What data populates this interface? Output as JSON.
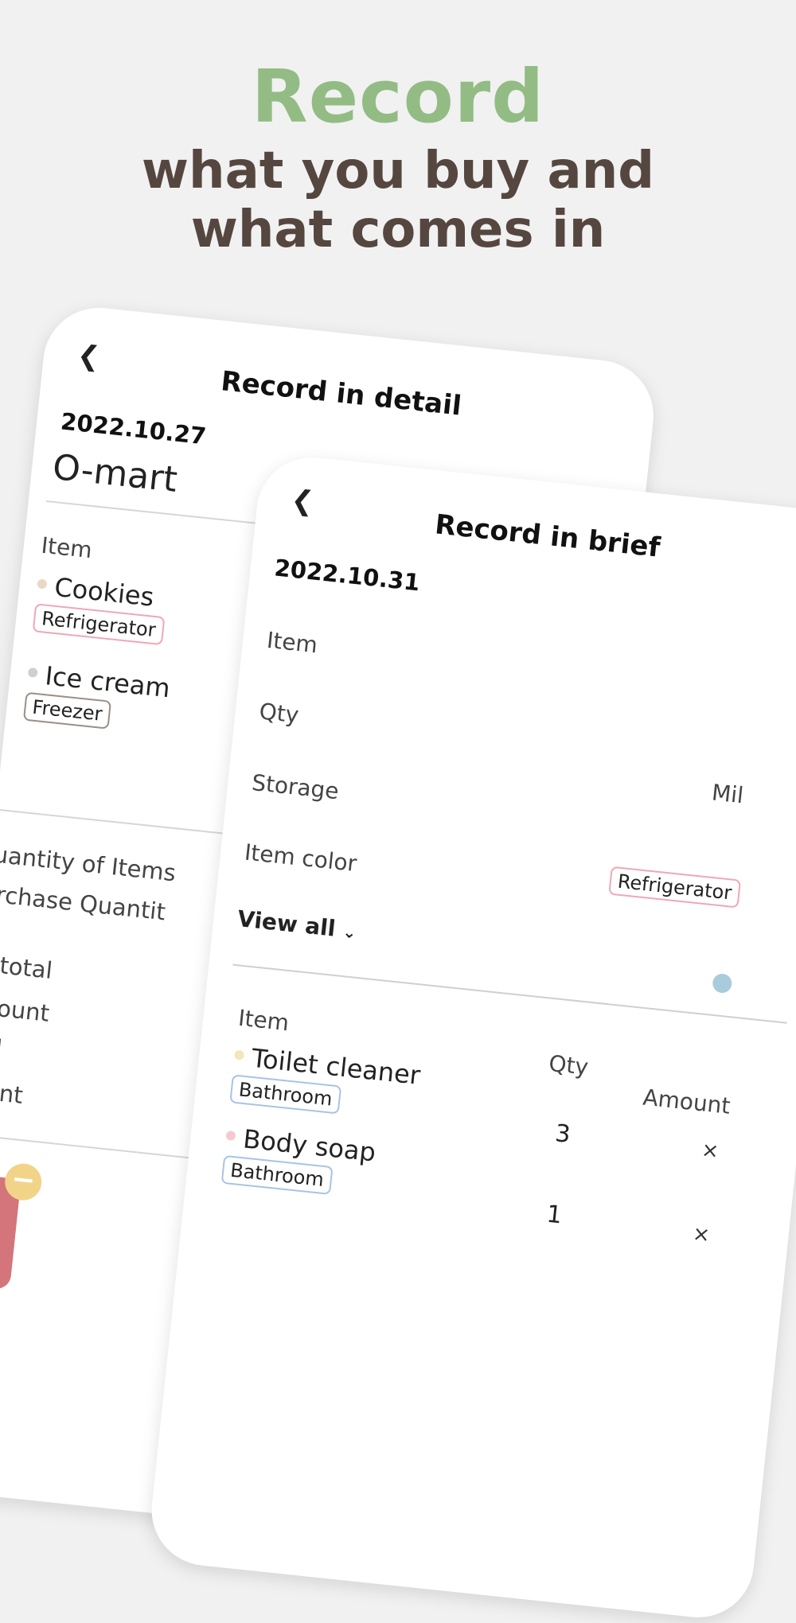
{
  "hero": {
    "title": "Record",
    "subtitle_line1": "what you buy and",
    "subtitle_line2": "what comes in"
  },
  "detail_card": {
    "header": "Record in detail",
    "back_icon": "chevron-left-icon",
    "date": "2022.10.27",
    "store": "O-mart",
    "item_label": "Item",
    "items": [
      {
        "name": "Cookies",
        "tag": "Refrigerator",
        "dot_color": "#ead9c2",
        "tag_color": "#f0a7b5"
      },
      {
        "name": "Ice cream",
        "tag": "Freezer",
        "dot_color": "#cfcfcf",
        "tag_color": "#9a8f88"
      }
    ],
    "summary": {
      "quantity_of_items": "Quantity of Items",
      "purchase_quantity": "Purchase Quantit",
      "subtotal": "Subtotal",
      "discount": "Discount",
      "total": "otal",
      "payment": "yment"
    },
    "photo_badge": "−"
  },
  "brief_card": {
    "header": "Record in brief",
    "back_icon": "chevron-left-icon",
    "date": "2022.10.31",
    "fields": {
      "item": "Item",
      "qty": "Qty",
      "storage": "Storage",
      "item_color": "Item color",
      "qty_value_partial": "Mil",
      "storage_tag": "Refrigerator",
      "color_dot": "#a8ccdc"
    },
    "view_all": "View all",
    "list_header": {
      "item": "Item",
      "qty": "Qty",
      "amount": "Amount"
    },
    "list_items": [
      {
        "name": "Toilet cleaner",
        "tag": "Bathroom",
        "qty": "3",
        "amount_icon": "×",
        "dot_color": "#f3e6b8"
      },
      {
        "name": "Body soap",
        "tag": "Bathroom",
        "qty": "1",
        "amount_icon": "×",
        "dot_color": "#f4c9d1"
      }
    ]
  }
}
